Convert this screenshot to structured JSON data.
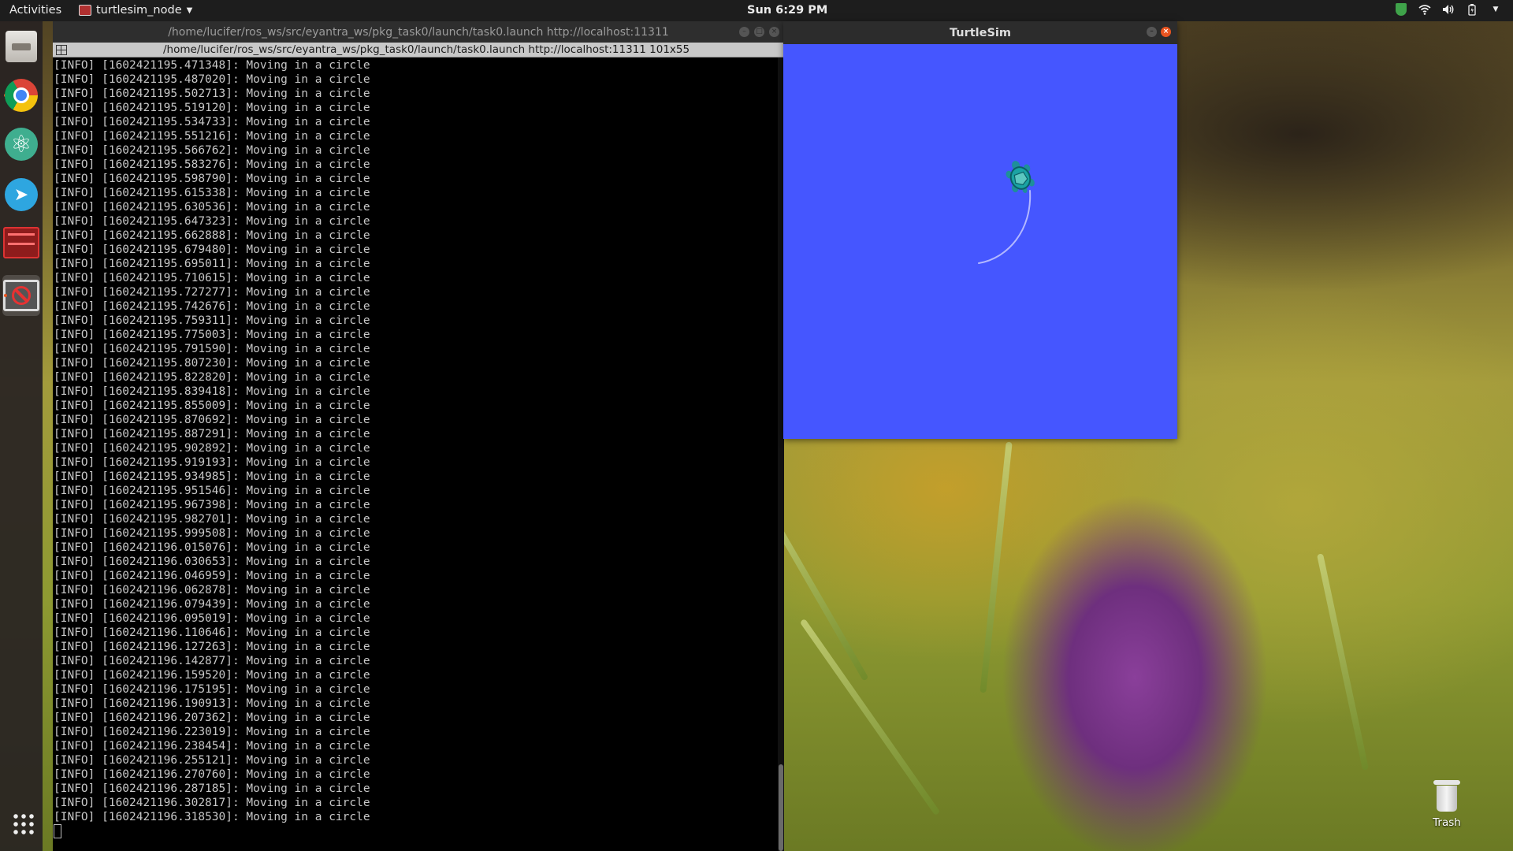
{
  "topbar": {
    "activities": "Activities",
    "app_name": "turtlesim_node",
    "clock": "Sun  6:29 PM"
  },
  "dock": {
    "items": [
      "files",
      "chrome",
      "atom",
      "telegram",
      "terminal",
      "turtlesim"
    ],
    "active_item": "turtlesim"
  },
  "terminal": {
    "window_title": "/home/lucifer/ros_ws/src/eyantra_ws/pkg_task0/launch/task0.launch http://localhost:11311",
    "tab_title": "/home/lucifer/ros_ws/src/eyantra_ws/pkg_task0/launch/task0.launch http://localhost:11311 101x55",
    "log_lines": [
      "[INFO] [1602421195.471348]: Moving in a circle",
      "[INFO] [1602421195.487020]: Moving in a circle",
      "[INFO] [1602421195.502713]: Moving in a circle",
      "[INFO] [1602421195.519120]: Moving in a circle",
      "[INFO] [1602421195.534733]: Moving in a circle",
      "[INFO] [1602421195.551216]: Moving in a circle",
      "[INFO] [1602421195.566762]: Moving in a circle",
      "[INFO] [1602421195.583276]: Moving in a circle",
      "[INFO] [1602421195.598790]: Moving in a circle",
      "[INFO] [1602421195.615338]: Moving in a circle",
      "[INFO] [1602421195.630536]: Moving in a circle",
      "[INFO] [1602421195.647323]: Moving in a circle",
      "[INFO] [1602421195.662888]: Moving in a circle",
      "[INFO] [1602421195.679480]: Moving in a circle",
      "[INFO] [1602421195.695011]: Moving in a circle",
      "[INFO] [1602421195.710615]: Moving in a circle",
      "[INFO] [1602421195.727277]: Moving in a circle",
      "[INFO] [1602421195.742676]: Moving in a circle",
      "[INFO] [1602421195.759311]: Moving in a circle",
      "[INFO] [1602421195.775003]: Moving in a circle",
      "[INFO] [1602421195.791590]: Moving in a circle",
      "[INFO] [1602421195.807230]: Moving in a circle",
      "[INFO] [1602421195.822820]: Moving in a circle",
      "[INFO] [1602421195.839418]: Moving in a circle",
      "[INFO] [1602421195.855009]: Moving in a circle",
      "[INFO] [1602421195.870692]: Moving in a circle",
      "[INFO] [1602421195.887291]: Moving in a circle",
      "[INFO] [1602421195.902892]: Moving in a circle",
      "[INFO] [1602421195.919193]: Moving in a circle",
      "[INFO] [1602421195.934985]: Moving in a circle",
      "[INFO] [1602421195.951546]: Moving in a circle",
      "[INFO] [1602421195.967398]: Moving in a circle",
      "[INFO] [1602421195.982701]: Moving in a circle",
      "[INFO] [1602421195.999508]: Moving in a circle",
      "[INFO] [1602421196.015076]: Moving in a circle",
      "[INFO] [1602421196.030653]: Moving in a circle",
      "[INFO] [1602421196.046959]: Moving in a circle",
      "[INFO] [1602421196.062878]: Moving in a circle",
      "[INFO] [1602421196.079439]: Moving in a circle",
      "[INFO] [1602421196.095019]: Moving in a circle",
      "[INFO] [1602421196.110646]: Moving in a circle",
      "[INFO] [1602421196.127263]: Moving in a circle",
      "[INFO] [1602421196.142877]: Moving in a circle",
      "[INFO] [1602421196.159520]: Moving in a circle",
      "[INFO] [1602421196.175195]: Moving in a circle",
      "[INFO] [1602421196.190913]: Moving in a circle",
      "[INFO] [1602421196.207362]: Moving in a circle",
      "[INFO] [1602421196.223019]: Moving in a circle",
      "[INFO] [1602421196.238454]: Moving in a circle",
      "[INFO] [1602421196.255121]: Moving in a circle",
      "[INFO] [1602421196.270760]: Moving in a circle",
      "[INFO] [1602421196.287185]: Moving in a circle",
      "[INFO] [1602421196.302817]: Moving in a circle",
      "[INFO] [1602421196.318530]: Moving in a circle"
    ]
  },
  "turtlesim": {
    "window_title": "TurtleSim",
    "background_color": "#4556ff",
    "pen_color": "#b3b8ff",
    "turtle_icon": "turtle-icon"
  },
  "desktop": {
    "trash_label": "Trash"
  }
}
